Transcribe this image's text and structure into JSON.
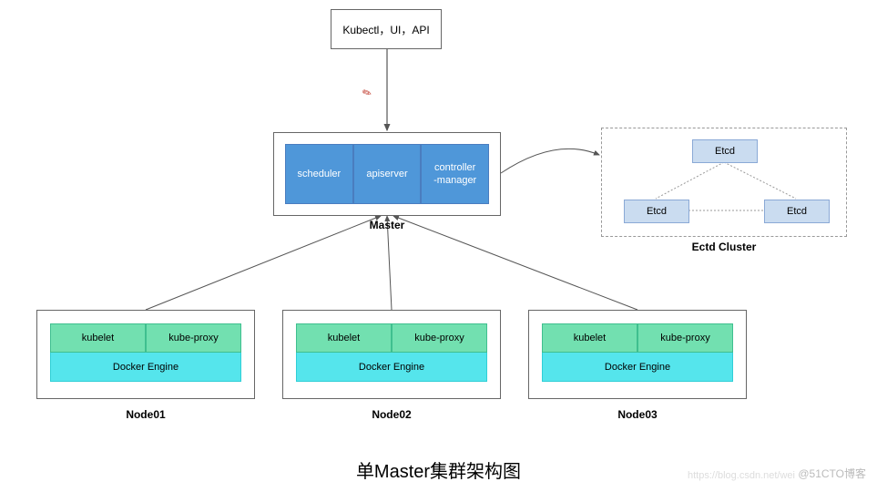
{
  "client": {
    "label": "Kubectl，UI，API"
  },
  "master": {
    "label": "Master",
    "scheduler": "scheduler",
    "apiserver": "apiserver",
    "controller_manager": "controller\n-manager"
  },
  "etcd": {
    "cluster_label": "Ectd Cluster",
    "top": "Etcd",
    "bl": "Etcd",
    "br": "Etcd"
  },
  "nodes": [
    {
      "label": "Node01",
      "kubelet": "kubelet",
      "kube_proxy": "kube-proxy",
      "docker": "Docker Engine"
    },
    {
      "label": "Node02",
      "kubelet": "kubelet",
      "kube_proxy": "kube-proxy",
      "docker": "Docker Engine"
    },
    {
      "label": "Node03",
      "kubelet": "kubelet",
      "kube_proxy": "kube-proxy",
      "docker": "Docker Engine"
    }
  ],
  "title": "单Master集群架构图",
  "watermark": "@51CTO博客",
  "watermark2": "https://blog.csdn.net/wei",
  "colors": {
    "master_fill": "#4f97d9",
    "etcd_fill": "#cadcf0",
    "kubelet_fill": "#72e0b0",
    "docker_fill": "#55e5ec"
  }
}
